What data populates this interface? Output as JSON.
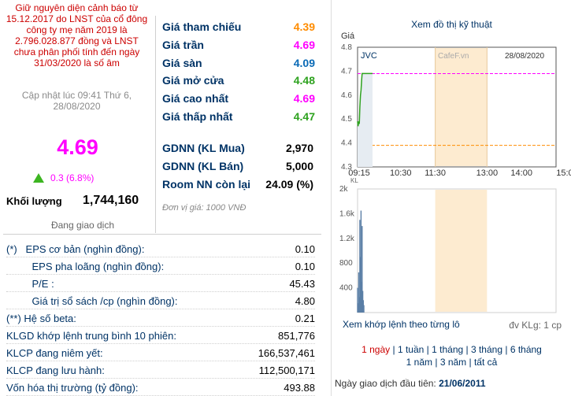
{
  "left": {
    "warning": "Giữ nguyên diện cảnh báo từ 15.12.2017 do LNST của cổ đông công ty mẹ năm 2019 là 2.796.028.877 đồng và LNST chưa phân phối tính đến ngày 31/03/2020 là số âm",
    "updated": "Cập nhật lúc 09:41 Thứ 6, 28/08/2020",
    "price": "4.69",
    "change": "0.3 (6.8%)",
    "volume_label": "Khối lượng",
    "volume_value": "1,744,160",
    "trading_status": "Đang giao dịch"
  },
  "prices": [
    {
      "label": "Giá tham chiếu",
      "value": "4.39"
    },
    {
      "label": "Giá trần",
      "value": "4.69"
    },
    {
      "label": "Giá sàn",
      "value": "4.09"
    },
    {
      "label": "Giá mở cửa",
      "value": "4.48"
    },
    {
      "label": "Giá cao nhất",
      "value": "4.69"
    },
    {
      "label": "Giá thấp nhất",
      "value": "4.47"
    }
  ],
  "foreign": [
    {
      "label": "GDNN (KL Mua)",
      "value": "2,970"
    },
    {
      "label": "GDNN (KL Bán)",
      "value": "5,000"
    },
    {
      "label": "Room NN còn lại",
      "value": "24.09 (%)"
    }
  ],
  "unit_note": "Đơn vị giá: 1000 VNĐ",
  "chart": {
    "title": "Xem đồ thị kỹ thuật",
    "symbol": "JVC",
    "watermark": "CafeF.vn",
    "date": "28/08/2020",
    "price_axis_label": "Giá",
    "price_ticks": [
      "4.8",
      "4.7",
      "4.6",
      "4.5",
      "4.4",
      "4.3"
    ],
    "time_ticks": [
      "09:15",
      "10:30",
      "11:30",
      "13:00",
      "14:00",
      "15:00"
    ],
    "volume_ticks": [
      "2k",
      "1.6k",
      "1.2k",
      "800",
      "400"
    ],
    "kl_label": "KL",
    "ref_price": 4.39,
    "ceiling_price": 4.69,
    "price_series": [
      {
        "t": "09:15",
        "p": 4.49
      },
      {
        "t": "09:16",
        "p": 4.47
      },
      {
        "t": "09:17",
        "p": 4.49
      },
      {
        "t": "09:18",
        "p": 4.48
      },
      {
        "t": "09:19",
        "p": 4.55
      },
      {
        "t": "09:20",
        "p": 4.6
      },
      {
        "t": "09:21",
        "p": 4.62
      },
      {
        "t": "09:22",
        "p": 4.66
      },
      {
        "t": "09:23",
        "p": 4.69
      },
      {
        "t": "09:41",
        "p": 4.69
      }
    ],
    "volume_series": [
      {
        "t": "09:15",
        "v": 400
      },
      {
        "t": "09:16",
        "v": 150
      },
      {
        "t": "09:17",
        "v": 650
      },
      {
        "t": "09:18",
        "v": 250
      },
      {
        "t": "09:19",
        "v": 1500
      },
      {
        "t": "09:20",
        "v": 900
      },
      {
        "t": "09:21",
        "v": 1650
      },
      {
        "t": "09:22",
        "v": 500
      },
      {
        "t": "09:23",
        "v": 1400
      },
      {
        "t": "09:24",
        "v": 350
      },
      {
        "t": "09:25",
        "v": 200
      },
      {
        "t": "09:26",
        "v": 120
      }
    ],
    "lunch_break": [
      "11:30",
      "13:00"
    ],
    "colors": {
      "ref": "#ff8c00",
      "ceiling": "#ff00ff",
      "price": "#2ea21f",
      "volume": "#5b7fa6",
      "lunch": "#fdebd0"
    },
    "tick_detail": "Xem khớp lệnh theo từng lô",
    "volume_unit": "đv KLg: 1 cp",
    "ranges_row1": [
      "1 ngày",
      "1 tuần",
      "1 tháng",
      "3 tháng",
      "6 tháng"
    ],
    "ranges_row2": [
      "1 năm",
      "3 năm",
      "tất cả"
    ],
    "first_trade_label": "Ngày giao dịch đầu tiên:",
    "first_trade_value": "21/06/2011"
  },
  "fundamentals": [
    {
      "label": "(*)   EPS cơ bản (nghìn đồng):",
      "value": "0.10"
    },
    {
      "label": "         EPS pha loãng (nghìn đồng):",
      "value": "0.10"
    },
    {
      "label": "         P/E :",
      "value": "45.43"
    },
    {
      "label": "         Giá trị sổ sách /cp (nghìn đồng):",
      "value": "4.80"
    },
    {
      "label": "(**) Hệ số beta:",
      "value": "0.21"
    },
    {
      "label": "KLGD khớp lệnh trung bình 10 phiên:",
      "value": "851,776"
    },
    {
      "label": "KLCP đang niêm yết:",
      "value": "166,537,461"
    },
    {
      "label": "KLCP đang lưu hành:",
      "value": "112,500,171"
    },
    {
      "label": "Vốn hóa thị trường (tỷ đồng):",
      "value": "493.88"
    }
  ]
}
